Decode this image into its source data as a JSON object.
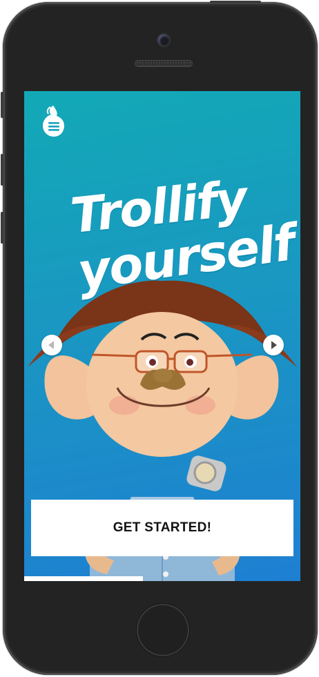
{
  "app": {
    "title_line1": "Trollify",
    "title_line2": "yourself"
  },
  "cta": {
    "label": "GET STARTED!"
  },
  "progress": {
    "fraction": 0.43
  },
  "icons": {
    "menu": "flame-menu-icon",
    "prev": "chevron-left-icon",
    "next": "chevron-right-icon"
  },
  "colors": {
    "gradient_top": "#12a9b6",
    "gradient_bottom": "#1e7fd2",
    "button_bg": "#ffffff",
    "button_text": "#111111"
  }
}
